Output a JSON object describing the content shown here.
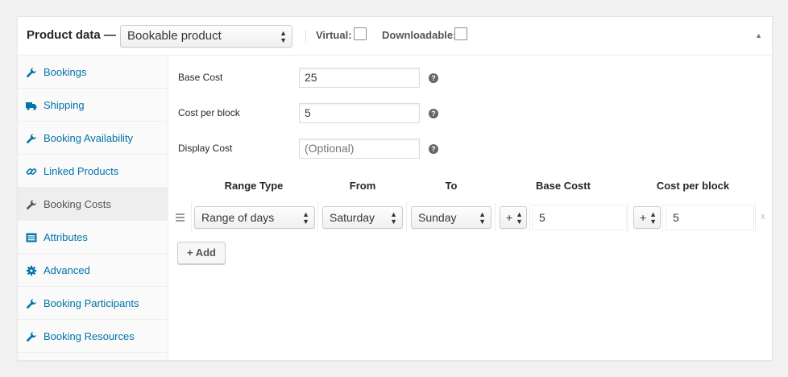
{
  "header": {
    "title": "Product data —",
    "product_type": "Bookable product",
    "virtual_label": "Virtual:",
    "downloadable_label": "Downloadable:"
  },
  "tabs": [
    {
      "label": "Bookings",
      "icon": "wrench-icon"
    },
    {
      "label": "Shipping",
      "icon": "truck-icon"
    },
    {
      "label": "Booking Availability",
      "icon": "wrench-icon"
    },
    {
      "label": "Linked Products",
      "icon": "link-icon"
    },
    {
      "label": "Booking Costs",
      "icon": "wrench-icon",
      "active": true
    },
    {
      "label": "Attributes",
      "icon": "list-icon"
    },
    {
      "label": "Advanced",
      "icon": "gear-icon"
    },
    {
      "label": "Booking Participants",
      "icon": "wrench-icon"
    },
    {
      "label": "Booking Resources",
      "icon": "wrench-icon"
    }
  ],
  "fields": {
    "base_cost": {
      "label": "Base Cost",
      "value": "25"
    },
    "cost_per_block": {
      "label": "Cost per block",
      "value": "5"
    },
    "display_cost": {
      "label": "Display Cost",
      "placeholder": "(Optional)"
    }
  },
  "costs_table": {
    "headers": [
      "Range Type",
      "From",
      "To",
      "Base Costt",
      "Cost per block"
    ],
    "row": {
      "range_type": "Range of days",
      "from": "Saturday",
      "to": "Sunday",
      "base_modifier": "+",
      "base_cost": "5",
      "block_modifier": "+",
      "block_cost": "5",
      "remove": "x"
    },
    "add_label": "+ Add"
  },
  "colors": {
    "link": "#0073aa",
    "active_tab_bg": "#eeeeee"
  }
}
